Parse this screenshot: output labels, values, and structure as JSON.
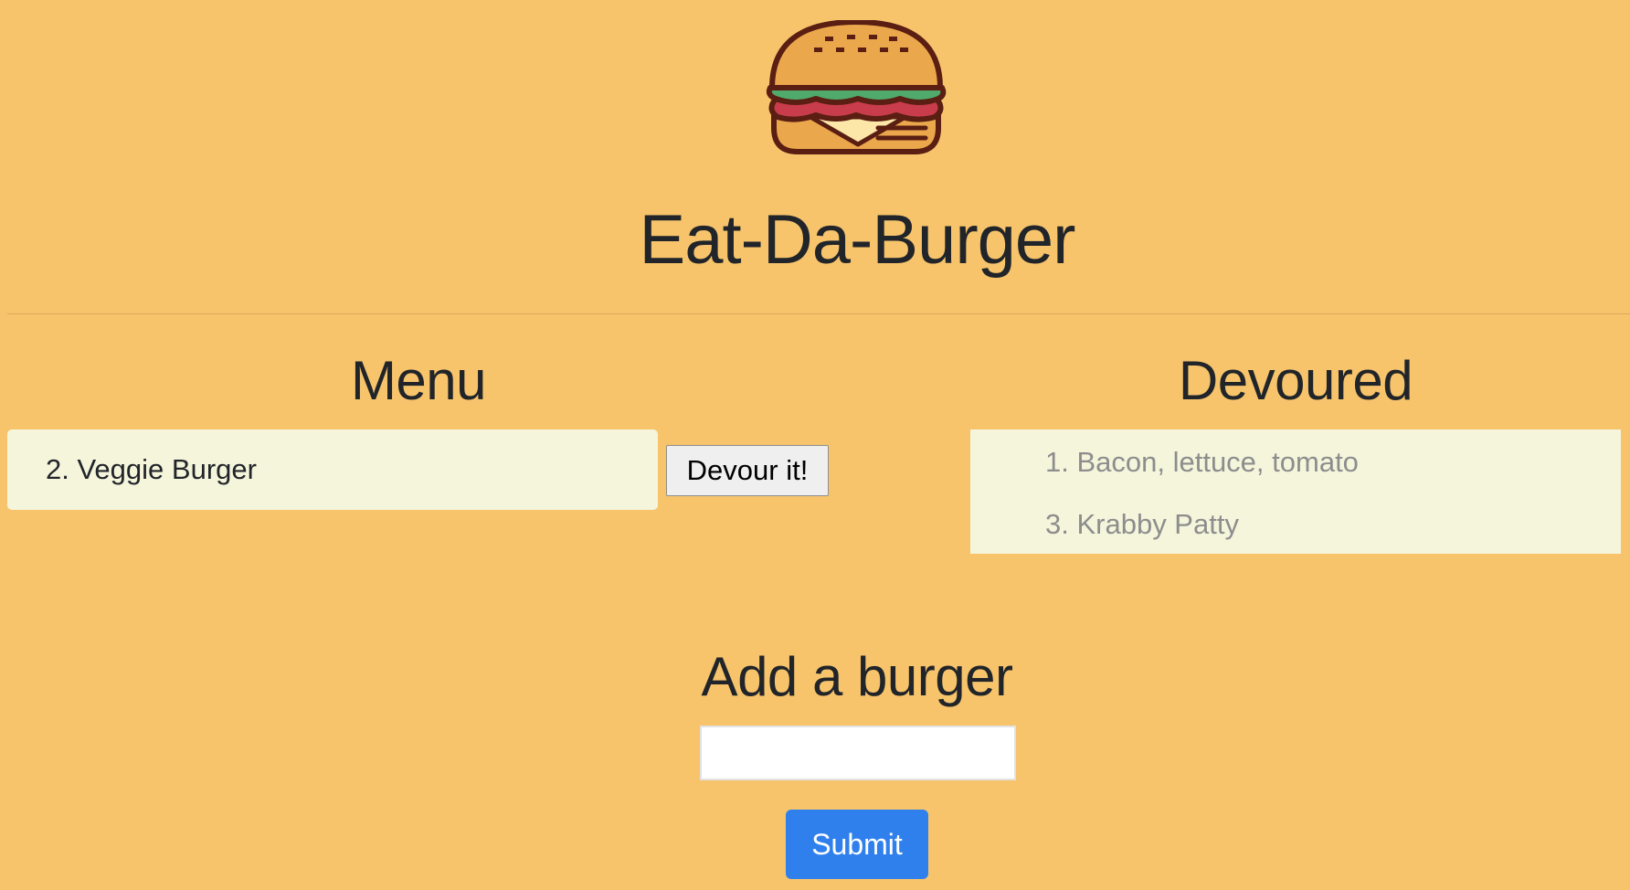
{
  "header": {
    "logo_icon": "burger-icon",
    "title": "Eat-Da-Burger"
  },
  "menu": {
    "heading": "Menu",
    "items": [
      {
        "label": "2. Veggie Burger",
        "action_label": "Devour it!"
      }
    ]
  },
  "devoured": {
    "heading": "Devoured",
    "items": [
      {
        "label": "1. Bacon, lettuce, tomato"
      },
      {
        "label": "3. Krabby Patty"
      }
    ]
  },
  "add_form": {
    "heading": "Add a burger",
    "input_value": "",
    "submit_label": "Submit"
  },
  "colors": {
    "background": "#f7c46c",
    "list_background": "#f5f5dc",
    "submit_button": "#2f80ed",
    "devoured_text": "#8d8d8d"
  }
}
